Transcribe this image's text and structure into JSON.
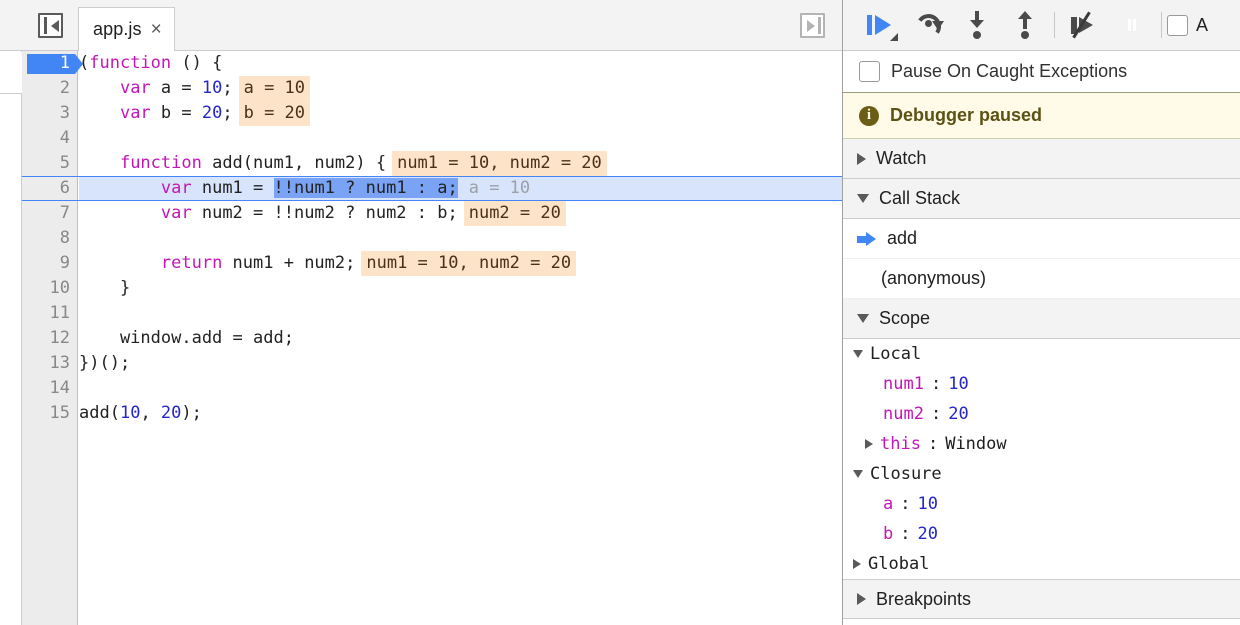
{
  "sources": {
    "navigator_toggle_icon": "show-navigator-icon",
    "debugger_toggle_icon": "show-debugger-icon",
    "tab": {
      "label": "app.js",
      "close": "×"
    },
    "code_lines": [
      {
        "n": "1",
        "breakpoint": true,
        "executing": false,
        "tokens": [
          {
            "t": "(",
            "c": ""
          },
          {
            "t": "function",
            "c": "kw"
          },
          {
            "t": " () {",
            "c": ""
          }
        ],
        "hint": ""
      },
      {
        "n": "2",
        "breakpoint": false,
        "executing": false,
        "tokens": [
          {
            "t": "    ",
            "c": ""
          },
          {
            "t": "var",
            "c": "kw"
          },
          {
            "t": " a = ",
            "c": ""
          },
          {
            "t": "10",
            "c": "num"
          },
          {
            "t": ";",
            "c": ""
          }
        ],
        "hint": "a = 10"
      },
      {
        "n": "3",
        "breakpoint": false,
        "executing": false,
        "tokens": [
          {
            "t": "    ",
            "c": ""
          },
          {
            "t": "var",
            "c": "kw"
          },
          {
            "t": " b = ",
            "c": ""
          },
          {
            "t": "20",
            "c": "num"
          },
          {
            "t": ";",
            "c": ""
          }
        ],
        "hint": "b = 20"
      },
      {
        "n": "4",
        "breakpoint": false,
        "executing": false,
        "tokens": [],
        "hint": ""
      },
      {
        "n": "5",
        "breakpoint": false,
        "executing": false,
        "tokens": [
          {
            "t": "    ",
            "c": ""
          },
          {
            "t": "function",
            "c": "kw"
          },
          {
            "t": " add(num1, num2) {",
            "c": ""
          }
        ],
        "hint": "num1 = 10, num2 = 20"
      },
      {
        "n": "6",
        "breakpoint": false,
        "executing": true,
        "tokens": [
          {
            "t": "        ",
            "c": ""
          },
          {
            "t": "var",
            "c": "kw"
          },
          {
            "t": " num1 = ",
            "c": ""
          },
          {
            "t": "!!num1 ? num1 : a;",
            "c": "exec-sel"
          }
        ],
        "hint": "a = 10",
        "hint_muted": true
      },
      {
        "n": "7",
        "breakpoint": false,
        "executing": false,
        "tokens": [
          {
            "t": "        ",
            "c": ""
          },
          {
            "t": "var",
            "c": "kw"
          },
          {
            "t": " num2 = !!num2 ? num2 : b;",
            "c": ""
          }
        ],
        "hint": "num2 = 20"
      },
      {
        "n": "8",
        "breakpoint": false,
        "executing": false,
        "tokens": [],
        "hint": ""
      },
      {
        "n": "9",
        "breakpoint": false,
        "executing": false,
        "tokens": [
          {
            "t": "        ",
            "c": ""
          },
          {
            "t": "return",
            "c": "kw"
          },
          {
            "t": " num1 + num2;",
            "c": ""
          }
        ],
        "hint": "num1 = 10, num2 = 20"
      },
      {
        "n": "10",
        "breakpoint": false,
        "executing": false,
        "tokens": [
          {
            "t": "    }",
            "c": ""
          }
        ],
        "hint": ""
      },
      {
        "n": "11",
        "breakpoint": false,
        "executing": false,
        "tokens": [],
        "hint": ""
      },
      {
        "n": "12",
        "breakpoint": false,
        "executing": false,
        "tokens": [
          {
            "t": "    window.add = add;",
            "c": ""
          }
        ],
        "hint": ""
      },
      {
        "n": "13",
        "breakpoint": false,
        "executing": false,
        "tokens": [
          {
            "t": "})();",
            "c": ""
          }
        ],
        "hint": ""
      },
      {
        "n": "14",
        "breakpoint": false,
        "executing": false,
        "tokens": [],
        "hint": ""
      },
      {
        "n": "15",
        "breakpoint": false,
        "executing": false,
        "tokens": [
          {
            "t": "add(",
            "c": ""
          },
          {
            "t": "10",
            "c": "num"
          },
          {
            "t": ", ",
            "c": ""
          },
          {
            "t": "20",
            "c": "num"
          },
          {
            "t": ");",
            "c": ""
          }
        ],
        "hint": ""
      }
    ]
  },
  "debugger": {
    "toolbar": {
      "resume": "resume-script-execution",
      "step_over": "step-over-next-function-call",
      "step_into": "step-into-next-function-call",
      "step_out": "step-out-of-current-function",
      "deactivate_breakpoints": "deactivate-breakpoints",
      "pause_on_exceptions": "pause-on-exceptions",
      "async_label": "A"
    },
    "pause_on_caught": {
      "label": "Pause On Caught Exceptions",
      "checked": false
    },
    "banner": {
      "text": "Debugger paused",
      "icon": "info-icon"
    },
    "sections": {
      "watch": {
        "title": "Watch",
        "expanded": false
      },
      "call_stack": {
        "title": "Call Stack",
        "expanded": true,
        "frames": [
          {
            "name": "add",
            "selected": true
          },
          {
            "name": "(anonymous)",
            "selected": false
          }
        ]
      },
      "scope": {
        "title": "Scope",
        "expanded": true,
        "groups": [
          {
            "name": "Local",
            "expanded": true,
            "props": [
              {
                "name": "num1",
                "value": "10",
                "kind": "num",
                "expandable": false
              },
              {
                "name": "num2",
                "value": "20",
                "kind": "num",
                "expandable": false
              },
              {
                "name": "this",
                "value": "Window",
                "kind": "obj",
                "expandable": true
              }
            ]
          },
          {
            "name": "Closure",
            "expanded": true,
            "props": [
              {
                "name": "a",
                "value": "10",
                "kind": "num",
                "expandable": false
              },
              {
                "name": "b",
                "value": "20",
                "kind": "num",
                "expandable": false
              }
            ]
          },
          {
            "name": "Global",
            "expanded": false,
            "props": []
          }
        ]
      },
      "breakpoints": {
        "title": "Breakpoints",
        "expanded": false
      }
    },
    "colors": {
      "accent": "#4285f4",
      "hint_bg": "#fde3c8",
      "banner_bg": "#fffbe8",
      "exec_line_bg": "#d7e4fb",
      "keyword": "#c316b6",
      "number": "#2525cc"
    }
  }
}
